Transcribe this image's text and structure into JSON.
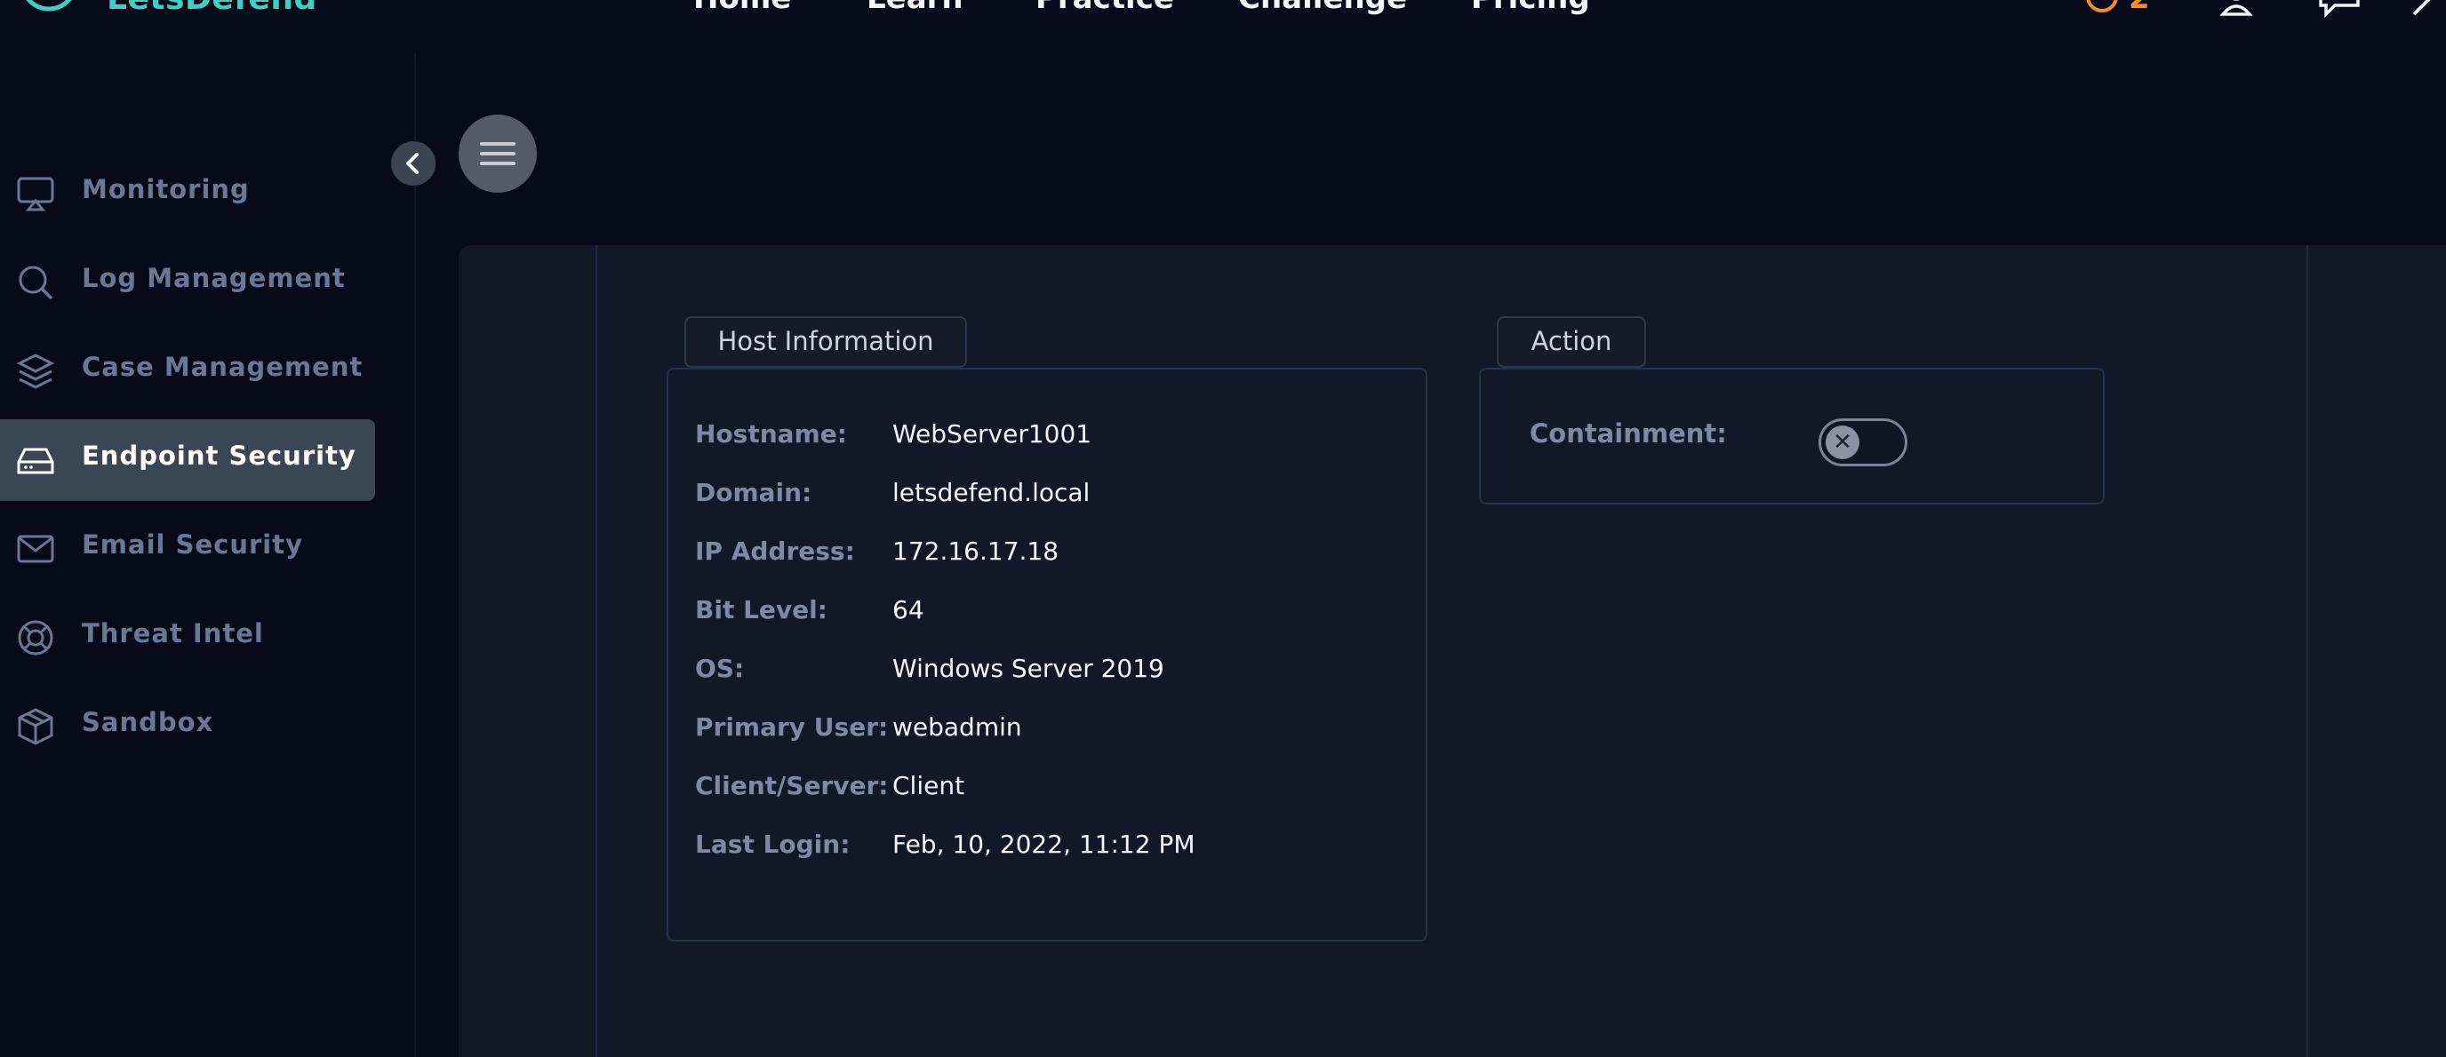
{
  "topbar": {
    "brand": "LetsDefend",
    "nav": [
      "Home",
      "Learn",
      "Practice",
      "Challenge",
      "Pricing ˅"
    ],
    "badge_count": "2",
    "icons": [
      "badge-icon",
      "user-icon",
      "chat-icon",
      "arrow-icon"
    ]
  },
  "sidebar": {
    "items": [
      {
        "label": "Monitoring",
        "icon": "monitor-icon"
      },
      {
        "label": "Log Management",
        "icon": "search-icon"
      },
      {
        "label": "Case Management",
        "icon": "layers-icon"
      },
      {
        "label": "Endpoint Security",
        "icon": "drive-icon",
        "active": true
      },
      {
        "label": "Email Security",
        "icon": "mail-icon"
      },
      {
        "label": "Threat Intel",
        "icon": "lifebuoy-icon"
      },
      {
        "label": "Sandbox",
        "icon": "cube-icon"
      }
    ]
  },
  "host_info": {
    "tab": "Host Information",
    "rows": [
      {
        "label": "Hostname:",
        "value": "WebServer1001"
      },
      {
        "label": "Domain:",
        "value": "letsdefend.local"
      },
      {
        "label": "IP Address:",
        "value": "172.16.17.18"
      },
      {
        "label": "Bit Level:",
        "value": "64"
      },
      {
        "label": "OS:",
        "value": "Windows Server 2019"
      },
      {
        "label": "Primary User:",
        "value": "webadmin"
      },
      {
        "label": "Client/Server:",
        "value": "Client"
      },
      {
        "label": "Last Login:",
        "value": "Feb, 10, 2022, 11:12 PM"
      }
    ]
  },
  "action": {
    "tab": "Action",
    "containment_label": "Containment:",
    "containment_on": false
  },
  "colors": {
    "background": "#070b19",
    "panel": "#111827",
    "active_item": "#3b4654",
    "brand": "#3fd0c4",
    "badge": "#f0902a"
  }
}
